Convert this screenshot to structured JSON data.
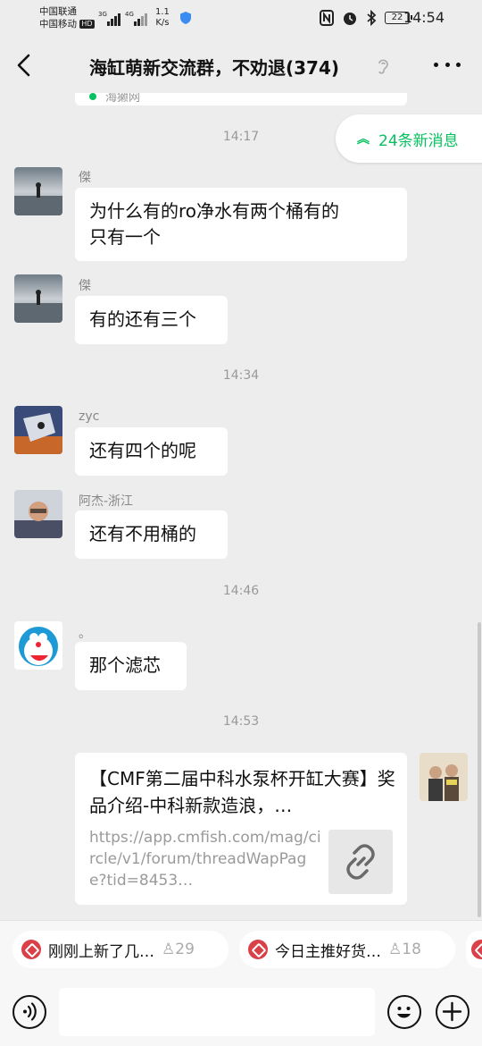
{
  "status_bar": {
    "carrier1": "中国联通",
    "carrier2": "中国移动",
    "hd_badge": "HD",
    "net_speed_value": "1.1",
    "net_speed_unit": "K/s",
    "battery": "22",
    "time": "14:54"
  },
  "header": {
    "title": "海缸萌新交流群，不劝退(374)",
    "back_icon": "chevron-left-icon",
    "mute_icon": "ear-icon",
    "more_icon": "more-dots-icon"
  },
  "new_messages": {
    "label": "24条新消息"
  },
  "previous_snippet": {
    "text": "海獭网"
  },
  "timestamps": [
    "14:17",
    "14:34",
    "14:46",
    "14:53"
  ],
  "messages": [
    {
      "sender": "傑",
      "text_line1": "为什么有的ro净水有两个桶有的",
      "text_line2": "只有一个"
    },
    {
      "sender": "傑",
      "text": "有的还有三个"
    },
    {
      "sender": "zyc",
      "text": "还有四个的呢"
    },
    {
      "sender": "阿杰-浙江",
      "text": "还有不用桶的"
    },
    {
      "sender": "。",
      "text": "那个滤芯"
    }
  ],
  "link_message": {
    "title": "【CMF第二届中科水泵杯开缸大赛】奖品介绍-中科新款造浪，…",
    "url": "https://app.cmfish.com/mag/circle/v1/forum/threadWapPage?tid=8453…",
    "thumb_icon": "link-icon"
  },
  "suggestions": [
    {
      "text": "刚刚上新了几…",
      "count": "29"
    },
    {
      "text": "今日主推好货…",
      "count": "18"
    }
  ],
  "input_bar": {
    "voice_icon": "voice-icon",
    "emoji_icon": "emoji-icon",
    "plus_icon": "plus-icon",
    "placeholder": ""
  },
  "colors": {
    "accent": "#07c160",
    "background": "#ededed",
    "bubble": "#ffffff",
    "meta_text": "#999999"
  }
}
